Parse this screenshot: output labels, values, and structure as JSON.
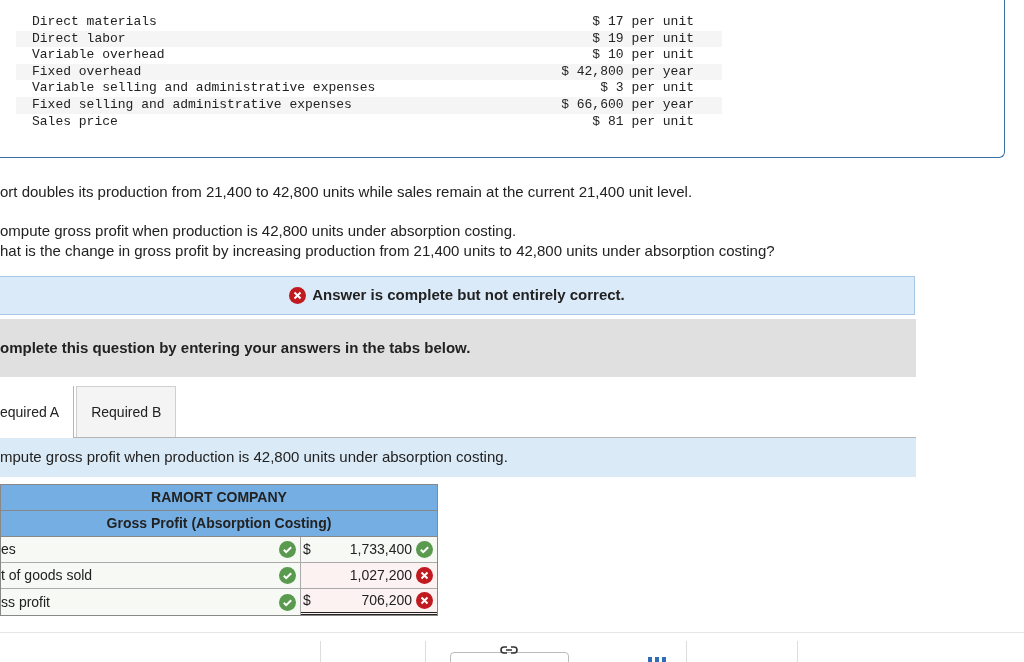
{
  "data_table": {
    "rows": [
      {
        "item": "Direct materials",
        "amount": "$ 17",
        "unit": "per unit"
      },
      {
        "item": "Direct labor",
        "amount": "$ 19",
        "unit": "per unit"
      },
      {
        "item": "Variable overhead",
        "amount": "$ 10",
        "unit": "per unit"
      },
      {
        "item": "Fixed overhead",
        "amount": "$ 42,800",
        "unit": "per year"
      },
      {
        "item": "Variable selling and administrative expenses",
        "amount": "$ 3",
        "unit": "per unit"
      },
      {
        "item": "Fixed selling and administrative expenses",
        "amount": "$ 66,600",
        "unit": "per year"
      },
      {
        "item": "Sales price",
        "amount": "$ 81",
        "unit": "per unit"
      }
    ]
  },
  "scenario": "ort doubles its production from 21,400 to 42,800 units while sales remain at the current 21,400 unit level.",
  "questions": [
    "ompute gross profit when production is 42,800 units under absorption costing.",
    "hat is the change in gross profit by increasing production from 21,400 units to 42,800 units under absorption costing?"
  ],
  "banner": {
    "correct": false,
    "text": "Answer is complete but not entirely correct."
  },
  "instruction": "omplete this question by entering your answers in the tabs below.",
  "tabs": [
    {
      "label": "equired A",
      "selected": true
    },
    {
      "label": "Required B",
      "selected": false
    }
  ],
  "prompt": "mpute gross profit when production is 42,800 units under absorption costing.",
  "statement": {
    "title": "RAMORT COMPANY",
    "subtitle": "Gross Profit (Absorption Costing)",
    "rows": [
      {
        "label": "es",
        "label_correct": true,
        "currency": "$",
        "value": "1,733,400",
        "value_correct": true
      },
      {
        "label": "t of goods sold",
        "label_correct": true,
        "value": "1,027,200",
        "value_correct": false
      },
      {
        "label": "ss profit",
        "label_correct": true,
        "currency": "$",
        "value": "706,200",
        "value_correct": false
      }
    ]
  }
}
